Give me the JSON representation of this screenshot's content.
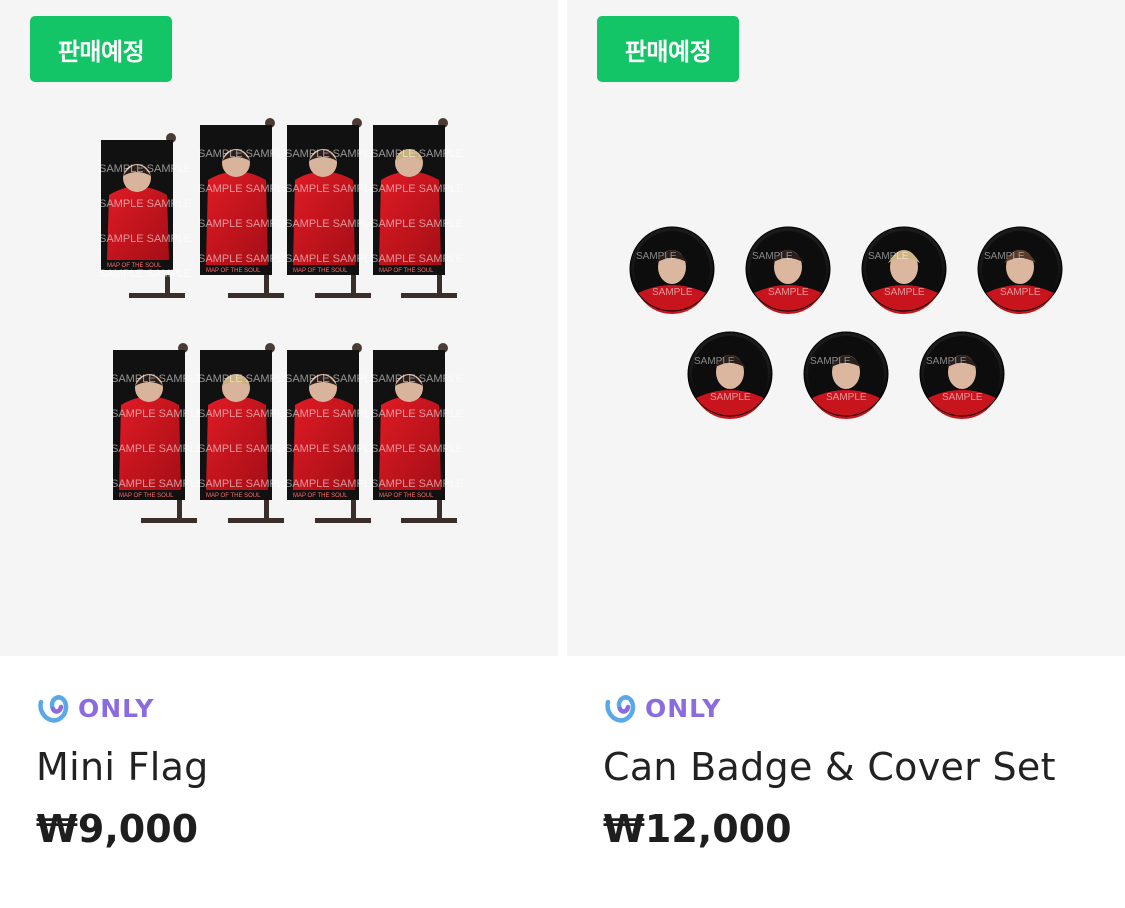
{
  "products": [
    {
      "badge": "판매예정",
      "brand_label": "ONLY",
      "brand_icon": "weverse-only-logo-icon",
      "title": "Mini Flag",
      "price": "₩9,000",
      "image_name": "mini-flag-product-image",
      "watermark": "SAMPLE",
      "print_text": "MAP OF THE SOUL"
    },
    {
      "badge": "판매예정",
      "brand_label": "ONLY",
      "brand_icon": "weverse-only-logo-icon",
      "title": "Can Badge & Cover Set",
      "price": "₩12,000",
      "image_name": "can-badge-product-image",
      "watermark": "SAMPLE"
    }
  ],
  "colors": {
    "badge_bg": "#13c567",
    "only_text": "#8a6ce0",
    "thumb_bg": "#f5f5f5",
    "flag_red": "#c8141d",
    "flag_black": "#111111"
  }
}
